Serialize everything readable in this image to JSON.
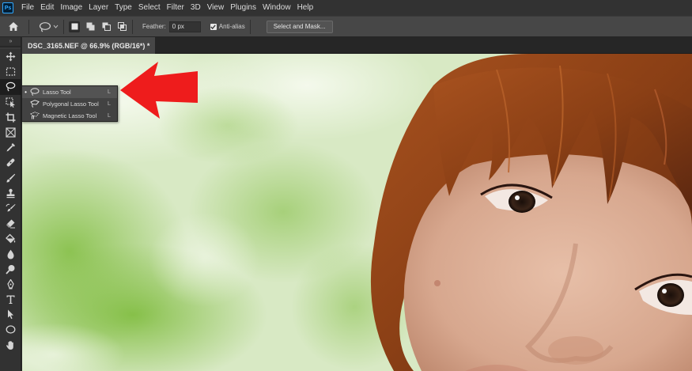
{
  "app": {
    "logo": "Ps",
    "accent": "#31a8ff"
  },
  "menu": {
    "items": [
      "File",
      "Edit",
      "Image",
      "Layer",
      "Type",
      "Select",
      "Filter",
      "3D",
      "View",
      "Plugins",
      "Window",
      "Help"
    ]
  },
  "options": {
    "home_icon": "home-icon",
    "tool_preset_icon": "lasso-icon",
    "selection_modes": [
      "new-selection",
      "add-to-selection",
      "subtract-from-selection",
      "intersect-with-selection"
    ],
    "feather_label": "Feather:",
    "feather_value": "0 px",
    "antialias_label": "Anti-alias",
    "antialias_checked": true,
    "select_and_mask_label": "Select and Mask..."
  },
  "document": {
    "tab_title": "DSC_3165.NEF @ 66.9% (RGB/16*) *"
  },
  "toolbar": {
    "collapse_glyph": "»",
    "tools": [
      "move-tool",
      "rectangular-marquee-tool",
      "lasso-tool",
      "object-selection-tool",
      "crop-tool",
      "frame-tool",
      "eyedropper-tool",
      "spot-healing-brush-tool",
      "brush-tool",
      "clone-stamp-tool",
      "history-brush-tool",
      "eraser-tool",
      "paint-bucket-tool",
      "blur-tool",
      "dodge-tool",
      "pen-tool",
      "type-tool",
      "path-selection-tool",
      "ellipse-tool",
      "hand-tool"
    ],
    "active_tool": "lasso-tool"
  },
  "flyout": {
    "items": [
      {
        "label": "Lasso Tool",
        "shortcut": "L",
        "icon": "lasso-icon",
        "current": true
      },
      {
        "label": "Polygonal Lasso Tool",
        "shortcut": "L",
        "icon": "polygonal-lasso-icon",
        "current": false
      },
      {
        "label": "Magnetic Lasso Tool",
        "shortcut": "L",
        "icon": "magnetic-lasso-icon",
        "current": false
      }
    ],
    "current_bullet": "•"
  },
  "annotation": {
    "arrow_color": "#ee1c1c"
  },
  "colors": {
    "menubar_bg": "#323232",
    "optionsbar_bg": "#474747",
    "panel_bg": "#323232",
    "tab_bg": "#474747",
    "flyout_bg": "#424242"
  }
}
